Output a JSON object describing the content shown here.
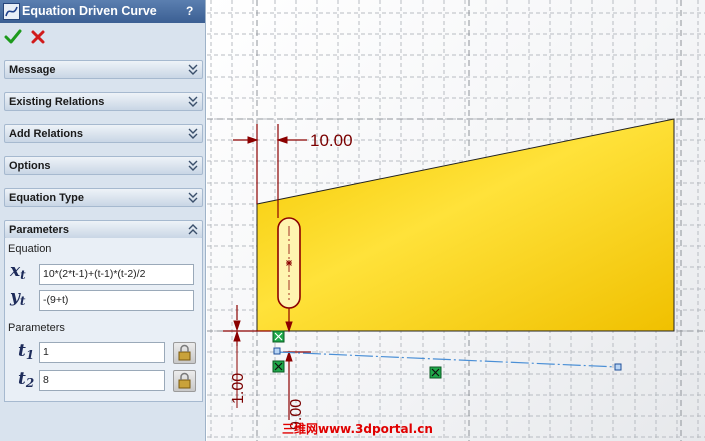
{
  "property_manager": {
    "title": "Equation Driven Curve",
    "help_label": "?",
    "groups": {
      "message": "Message",
      "existing_relations": "Existing Relations",
      "add_relations": "Add Relations",
      "options": "Options",
      "equation_type": "Equation Type",
      "parameters": "Parameters"
    },
    "parameters": {
      "equation_caption": "Equation",
      "x_var": "x",
      "x_sub": "t",
      "x_value": "10*(2*t-1)+(t-1)*(t-2)/2",
      "y_var": "y",
      "y_sub": "t",
      "y_value": "-(9+t)",
      "parameters_caption": "Parameters",
      "t1_var": "t",
      "t1_sub": "1",
      "t1_value": "1",
      "t2_var": "t",
      "t2_sub": "2",
      "t2_value": "8"
    }
  },
  "graphics": {
    "dim_horizontal": "10.00",
    "dim_vertical_left": "1.00",
    "dim_vertical_right": "9.00",
    "watermark": "三维网www.3dportal.cn"
  },
  "colors": {
    "part_fill": "#f6d400",
    "dimension": "#8b0000",
    "curve": "#4a8fd6",
    "panel_title": "#3b5f93"
  },
  "icons": [
    "equation-curve-icon",
    "help-icon",
    "ok-check-icon",
    "cancel-x-icon",
    "chevron-down-icon",
    "chevron-up-icon",
    "lock-icon"
  ]
}
